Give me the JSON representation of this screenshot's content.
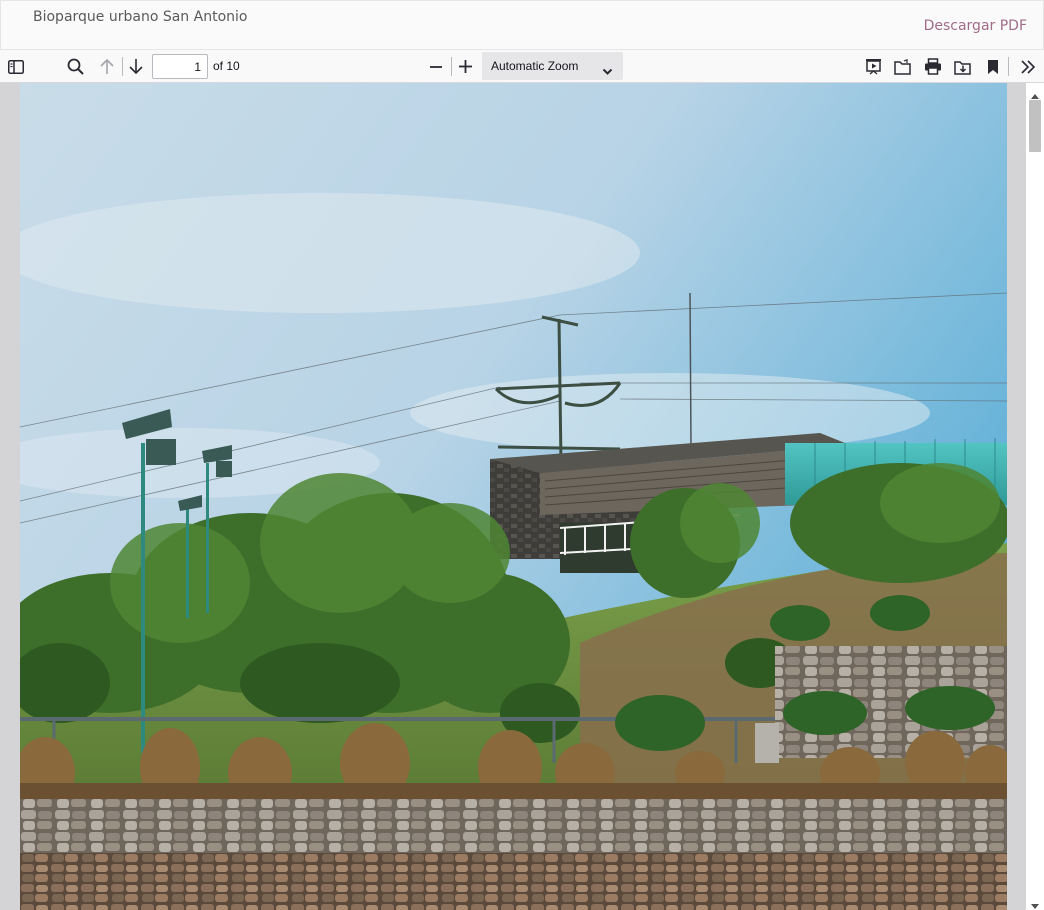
{
  "header": {
    "title": "Bioparque urbano San Antonio",
    "download_label": "Descargar PDF"
  },
  "toolbar": {
    "sidebar_toggle_icon": "sidebar-toggle-icon",
    "search_icon": "search-icon",
    "previous_page_icon": "arrow-up-icon",
    "next_page_icon": "arrow-down-icon",
    "page_number": "1",
    "page_count_label": "of 10",
    "zoom_out_icon": "minus-icon",
    "zoom_in_icon": "plus-icon",
    "zoom_value": "Automatic Zoom",
    "presentation_icon": "presentation-mode-icon",
    "open_file_icon": "open-file-icon",
    "print_icon": "print-icon",
    "save_icon": "download-icon",
    "bookmark_icon": "bookmark-icon",
    "tools_icon": "double-chevron-right-icon"
  },
  "document": {
    "current_page": 1,
    "total_pages": 10,
    "page_content": "photo-park-pavilion"
  },
  "colors": {
    "download_link": "#a06c89",
    "toolbar_bg": "#f9f9fa",
    "viewer_bg": "#d4d4d7",
    "sky_top": "#9cc3df",
    "sky_right": "#5aaed7",
    "foliage": "#3d6e2a",
    "glass_building": "#3fb6b3"
  },
  "scrollbar": {
    "position_fraction": 0.0
  }
}
